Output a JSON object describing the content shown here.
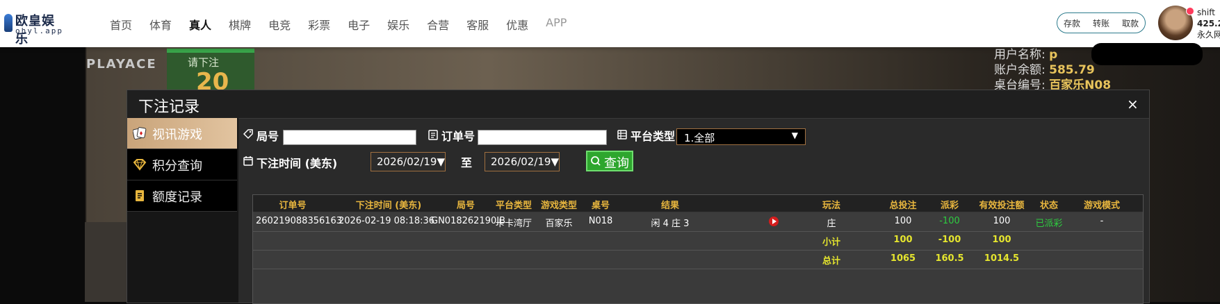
{
  "brand": {
    "name": "欧皇娱乐",
    "url": "ohyl.app"
  },
  "nav": [
    {
      "label": "首页"
    },
    {
      "label": "体育"
    },
    {
      "label": "真人",
      "active": true
    },
    {
      "label": "棋牌"
    },
    {
      "label": "电竞"
    },
    {
      "label": "彩票"
    },
    {
      "label": "电子"
    },
    {
      "label": "娱乐"
    },
    {
      "label": "合营"
    },
    {
      "label": "客服"
    },
    {
      "label": "优惠"
    },
    {
      "label": "APP"
    }
  ],
  "funds": {
    "deposit": "存款",
    "transfer": "转账",
    "withdraw": "取款"
  },
  "user": {
    "name": "shift",
    "balance": "425.2",
    "level": "永久网"
  },
  "background": {
    "bet_prompt": "请下注",
    "countdown": "20",
    "provider": "PLAYACE",
    "stats": [
      {
        "label": "用户名称:",
        "value": "p"
      },
      {
        "label": "账户余额:",
        "value": "585.79"
      },
      {
        "label": "桌台编号:",
        "value": "百家乐N08"
      }
    ]
  },
  "modal": {
    "title": "下注记录",
    "close": "×",
    "sidebar": [
      {
        "label": "视讯游戏",
        "icon": "cards-icon",
        "active": true
      },
      {
        "label": "积分查询",
        "icon": "diamond-icon"
      },
      {
        "label": "额度记录",
        "icon": "document-icon"
      }
    ],
    "filters": {
      "round_label": "局号",
      "order_label": "订单号",
      "platform_label": "平台类型",
      "platform_value": "1.全部",
      "time_label": "下注时间 (美东)",
      "date_from": "2026/02/19▼",
      "to_label": "至",
      "date_to": "2026/02/19▼",
      "query": "查询"
    },
    "table": {
      "headers": [
        "订单号",
        "下注时间 (美东)",
        "局号",
        "平台类型",
        "游戏类型",
        "桌号",
        "结果",
        "玩法",
        "总投注",
        "派彩",
        "有效投注额",
        "状态",
        "游戏模式"
      ],
      "row": {
        "order": "260219088356163",
        "time": "2026-02-19 08:18:36",
        "round": "GN018262190JB",
        "platform": "卡卡湾厅",
        "game": "百家乐",
        "table": "N018",
        "result": "闲 4 庄 3",
        "play": "庄",
        "bet": "100",
        "payout": "-100",
        "valid": "100",
        "status": "已派彩",
        "mode": "-"
      },
      "subtotal": {
        "label": "小计",
        "bet": "100",
        "payout": "-100",
        "valid": "100"
      },
      "total": {
        "label": "总计",
        "bet": "1065",
        "payout": "160.5",
        "valid": "1014.5"
      }
    }
  },
  "colors": {
    "accent": "#e8b63e",
    "query_button": "#2ea62e",
    "status_green": "#2ecc40",
    "active_tab": "#c9a47a"
  }
}
